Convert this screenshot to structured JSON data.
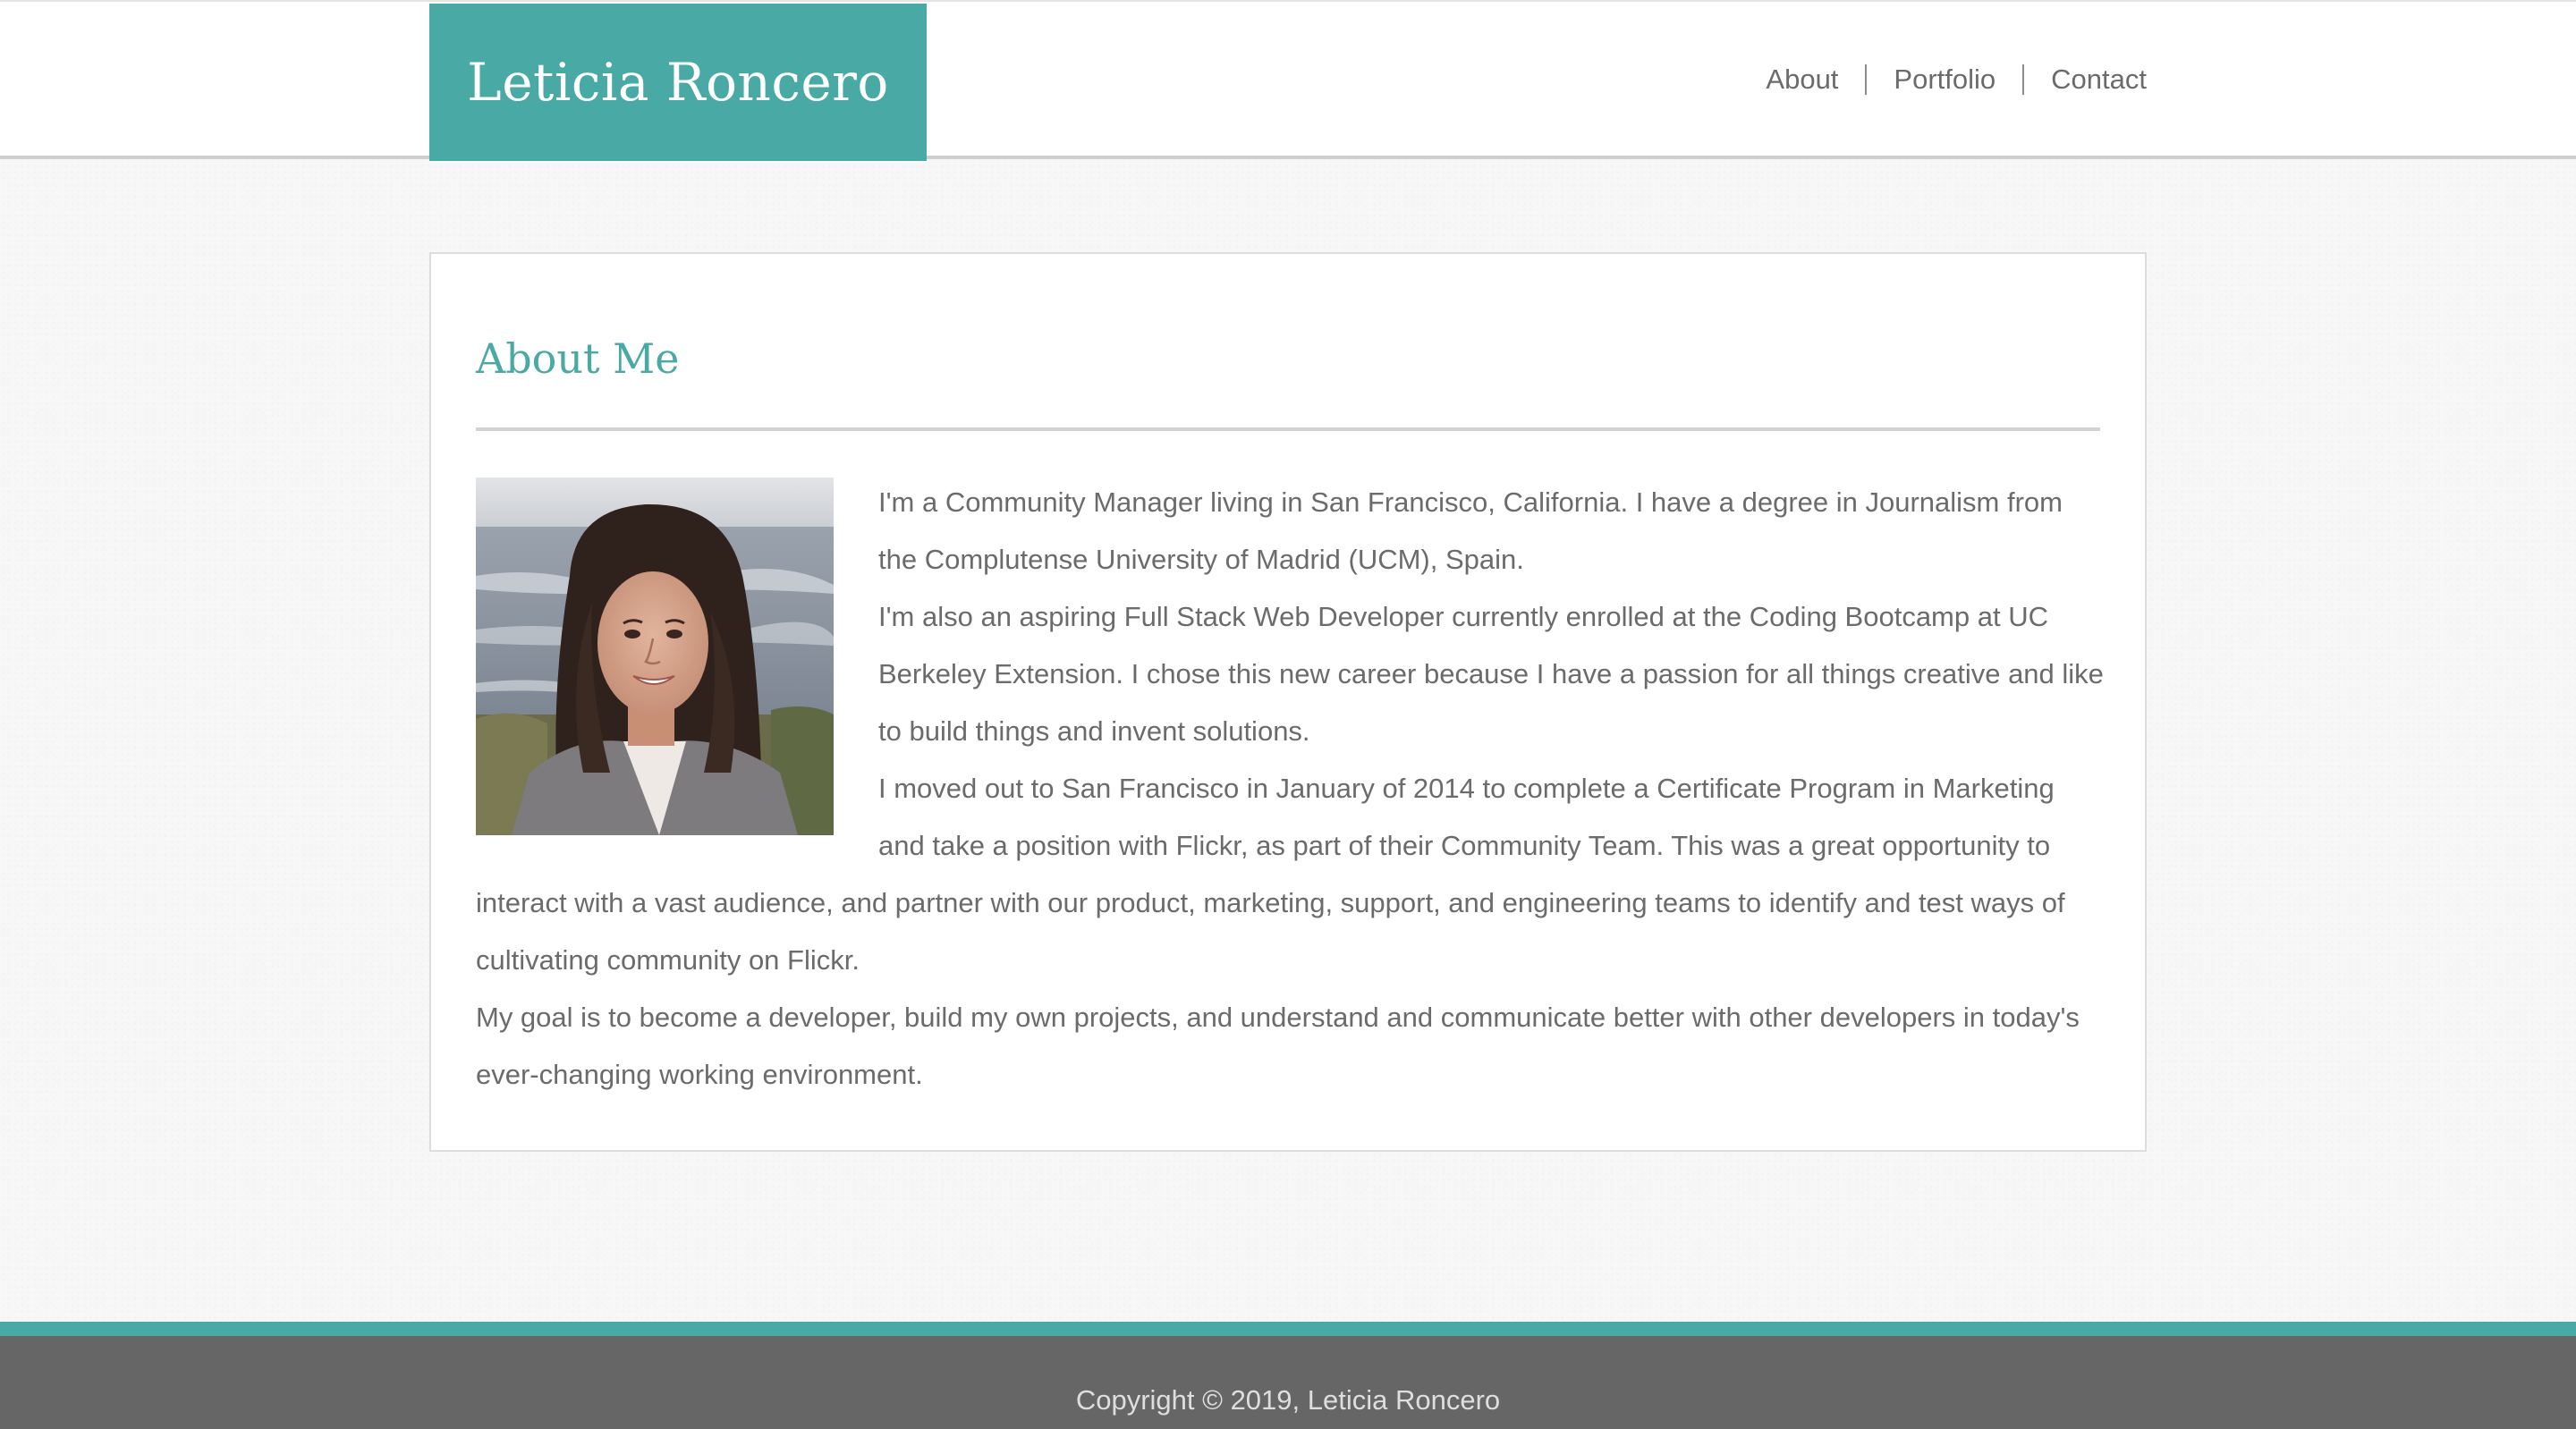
{
  "header": {
    "brand": "Leticia Roncero",
    "nav": [
      "About",
      "Portfolio",
      "Contact"
    ]
  },
  "about": {
    "title": "About Me",
    "photo_alt": "Portrait of Leticia Roncero by the ocean",
    "paragraphs": [
      "I'm a Community Manager living in San Francisco, California. I have a degree in Journalism from the Complutense University of Madrid (UCM), Spain.",
      "I'm also an aspiring Full Stack Web Developer currently enrolled at the Coding Bootcamp at UC Berkeley Extension. I chose this new career because I have a passion for all things creative and like to build things and invent solutions.",
      "I moved out to San Francisco in January of 2014 to complete a Certificate Program in Marketing and take a position with Flickr, as part of their Community Team. This was a great opportunity to interact with a vast audience, and partner with our product, marketing, support, and engineering teams to identify and test ways of cultivating community on Flickr.",
      "My goal is to become a developer, build my own projects, and understand and communicate better with other developers in today's ever-changing working environment."
    ]
  },
  "footer": {
    "copyright": "Copyright © 2019, Leticia Roncero"
  },
  "colors": {
    "accent": "#49a9a4",
    "text": "#6b6b6b",
    "footer_bg": "#666666"
  }
}
